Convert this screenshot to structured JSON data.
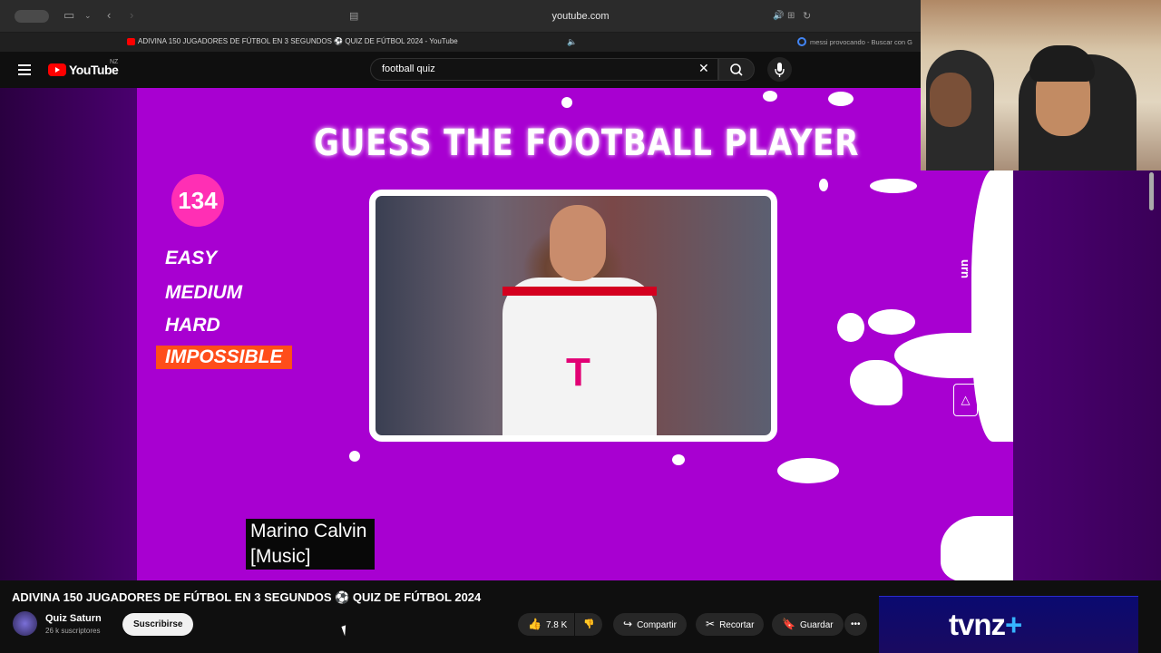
{
  "browser": {
    "url": "youtube.com",
    "active_tab_title": "ADIVINA 150 JUGADORES DE FÚTBOL EN 3 SEGUNDOS ⚽ QUIZ DE FÚTBOL 2024 - YouTube",
    "second_tab_title": "messi provocando - Buscar con G"
  },
  "youtube": {
    "logo_text": "YouTube",
    "region": "NZ",
    "search_value": "football quiz"
  },
  "video_overlay": {
    "banner": "GUESS THE FOOTBALL PLAYER",
    "counter": "134",
    "levels": [
      "EASY",
      "MEDIUM",
      "HARD",
      "IMPOSSIBLE"
    ],
    "active_level": "IMPOSSIBLE",
    "side_text": "urn",
    "caption_lines": [
      "Marino Calvin",
      "[Music]"
    ],
    "shirt_logo": "T"
  },
  "video_info": {
    "title": "ADIVINA 150 JUGADORES DE FÚTBOL EN 3 SEGUNDOS ⚽ QUIZ DE FÚTBOL 2024",
    "channel_name": "Quiz Saturn",
    "subscribers": "26 k suscriptores",
    "subscribe_label": "Suscribirse",
    "likes": "7.8 K",
    "share_label": "Compartir",
    "clip_label": "Recortar",
    "save_label": "Guardar"
  },
  "ad": {
    "logo": "tvnz",
    "plus": "+"
  },
  "colors": {
    "video_bg": "#a800d1",
    "accent_pink": "#ff2fb4",
    "impossible": "#ff4d1a",
    "yt_red": "#ff0000"
  }
}
